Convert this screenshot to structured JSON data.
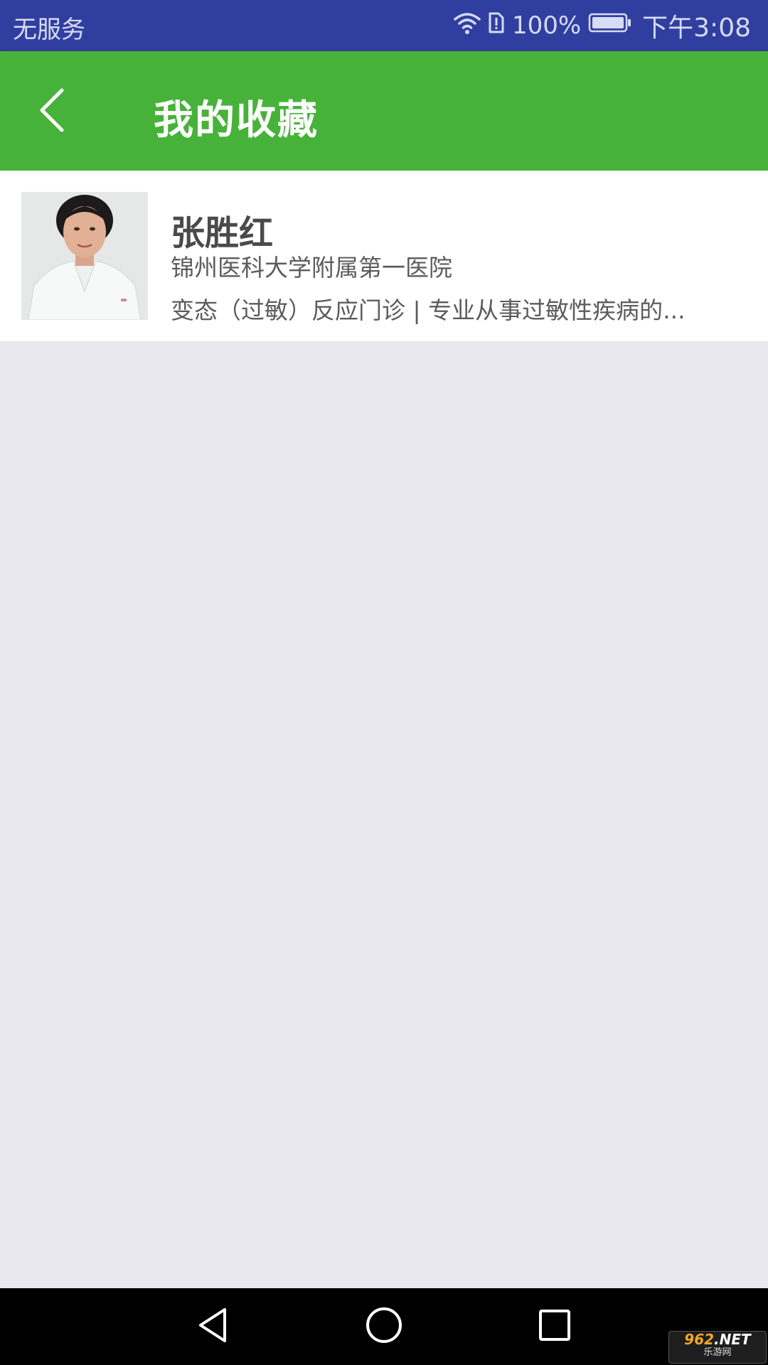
{
  "status_bar": {
    "carrier": "无服务",
    "battery": "100%",
    "time": "下午3:08",
    "icons": [
      "wifi-icon",
      "sim-alert-icon",
      "battery-icon"
    ]
  },
  "header": {
    "back_icon": "chevron-left-icon",
    "title": "我的收藏",
    "background_color": "#47b23a"
  },
  "favorites": [
    {
      "name": "张胜红",
      "hospital": "锦州医科大学附属第一医院",
      "specialty": "变态（过敏）反应门诊 | 专业从事过敏性疾病的..."
    }
  ],
  "nav_bar": {
    "icons": [
      "back-triangle-icon",
      "home-circle-icon",
      "recents-square-icon"
    ]
  },
  "watermark": {
    "number": "962",
    "suffix": ".NET",
    "sub": "乐游网"
  },
  "colors": {
    "status_bar": "#303f9f",
    "page_background": "#e8e8ee"
  }
}
